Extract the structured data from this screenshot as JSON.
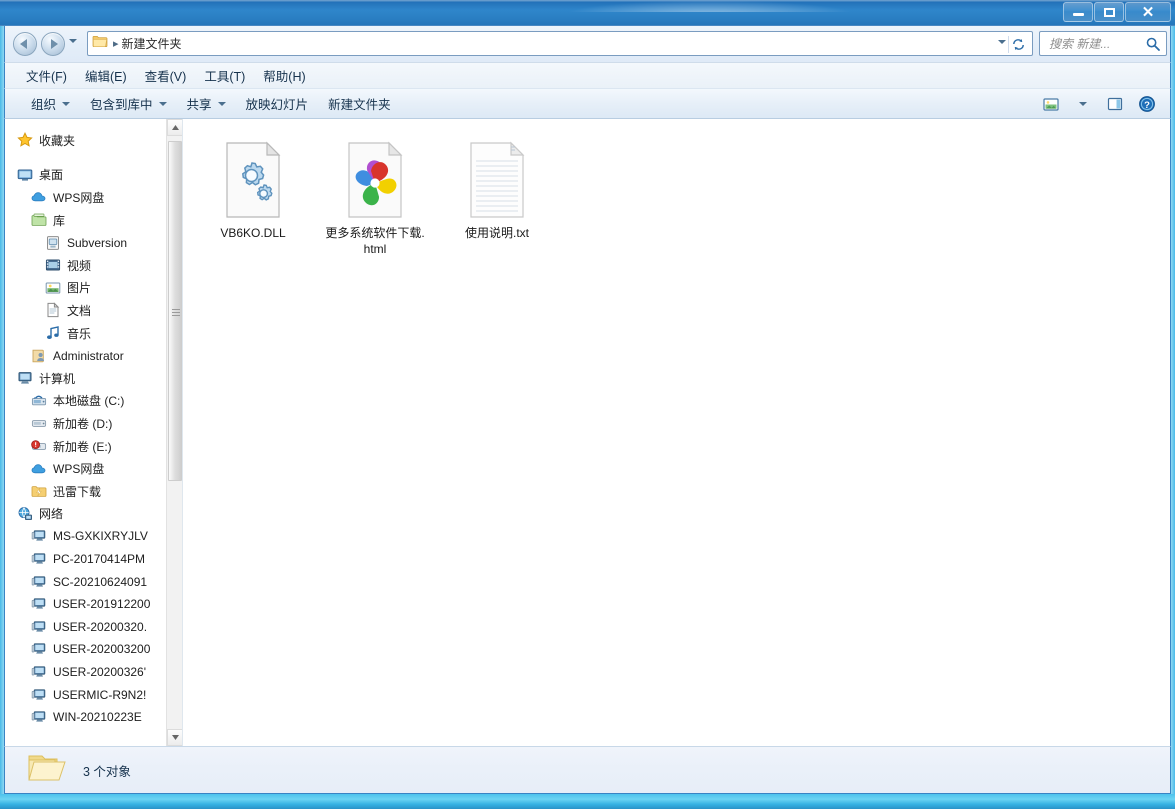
{
  "window": {
    "title": "",
    "controls": {
      "minimize": "–",
      "maximize": "□",
      "close": "✕"
    }
  },
  "address": {
    "folder_icon": "folder-icon",
    "separator": "▸",
    "crumb": "新建文件夹",
    "dropdown_icon": "chevron-down-icon",
    "refresh_icon": "refresh-icon"
  },
  "nav_buttons": {
    "back_icon": "arrow-left-icon",
    "forward_icon": "arrow-right-icon",
    "recent_icon": "chevron-down-icon"
  },
  "search": {
    "placeholder": "搜索 新建...",
    "value": "",
    "icon": "search-icon"
  },
  "menubar": {
    "items": [
      {
        "label": "文件(F)"
      },
      {
        "label": "编辑(E)"
      },
      {
        "label": "查看(V)"
      },
      {
        "label": "工具(T)"
      },
      {
        "label": "帮助(H)"
      }
    ]
  },
  "toolbar": {
    "items": [
      {
        "label": "组织",
        "has_caret": true
      },
      {
        "label": "包含到库中",
        "has_caret": true
      },
      {
        "label": "共享",
        "has_caret": true
      },
      {
        "label": "放映幻灯片",
        "has_caret": false
      },
      {
        "label": "新建文件夹",
        "has_caret": false
      }
    ],
    "right_icons": [
      {
        "name": "change-view-icon"
      },
      {
        "name": "chevron-down-icon"
      },
      {
        "name": "preview-pane-icon"
      },
      {
        "name": "help-icon"
      }
    ]
  },
  "sidebar": {
    "items": [
      {
        "label": "收藏夹",
        "icon": "star-icon",
        "level": 0,
        "gap_after": true
      },
      {
        "label": "桌面",
        "icon": "desktop-icon",
        "level": 0
      },
      {
        "label": "WPS网盘",
        "icon": "cloud-icon",
        "level": 1
      },
      {
        "label": "库",
        "icon": "library-icon",
        "level": 1
      },
      {
        "label": "Subversion",
        "icon": "subversion-icon",
        "level": 2
      },
      {
        "label": "视频",
        "icon": "video-icon",
        "level": 2
      },
      {
        "label": "图片",
        "icon": "pictures-icon",
        "level": 2
      },
      {
        "label": "文档",
        "icon": "documents-icon",
        "level": 2
      },
      {
        "label": "音乐",
        "icon": "music-icon",
        "level": 2
      },
      {
        "label": "Administrator",
        "icon": "user-icon",
        "level": 1
      },
      {
        "label": "计算机",
        "icon": "computer-icon",
        "level": 0
      },
      {
        "label": "本地磁盘 (C:)",
        "icon": "system-drive-icon",
        "level": 1
      },
      {
        "label": "新加卷 (D:)",
        "icon": "drive-icon",
        "level": 1
      },
      {
        "label": "新加卷 (E:)",
        "icon": "drive-warning-icon",
        "level": 1
      },
      {
        "label": "WPS网盘",
        "icon": "cloud-icon",
        "level": 1
      },
      {
        "label": "迅雷下载",
        "icon": "thunder-folder-icon",
        "level": 1
      },
      {
        "label": "网络",
        "icon": "network-icon",
        "level": 0
      },
      {
        "label": "MS-GXKIXRYJLV",
        "icon": "pc-icon",
        "level": 1
      },
      {
        "label": "PC-20170414PM",
        "icon": "pc-icon",
        "level": 1
      },
      {
        "label": "SC-20210624091",
        "icon": "pc-icon",
        "level": 1
      },
      {
        "label": "USER-201912200",
        "icon": "pc-icon",
        "level": 1
      },
      {
        "label": "USER-20200320.",
        "icon": "pc-icon",
        "level": 1
      },
      {
        "label": "USER-202003200",
        "icon": "pc-icon",
        "level": 1
      },
      {
        "label": "USER-20200326'",
        "icon": "pc-icon",
        "level": 1
      },
      {
        "label": "USERMIC-R9N2!",
        "icon": "pc-icon",
        "level": 1
      },
      {
        "label": "WIN-20210223E",
        "icon": "pc-icon",
        "level": 1
      }
    ],
    "scrollbar": {
      "up_icon": "triangle-up-icon",
      "down_icon": "triangle-down-icon"
    }
  },
  "files": [
    {
      "name": "VB6KO.DLL",
      "icon": "dll-gears-icon"
    },
    {
      "name": "更多系统软件下载.html",
      "icon": "chrome-html-icon"
    },
    {
      "name": "使用说明.txt",
      "icon": "text-file-icon"
    }
  ],
  "statusbar": {
    "folder_icon": "open-folder-icon",
    "text": "3 个对象"
  },
  "colors": {
    "accent": "#2f86cb",
    "frame_glow": "#4fc6ef",
    "text": "#16324d"
  }
}
